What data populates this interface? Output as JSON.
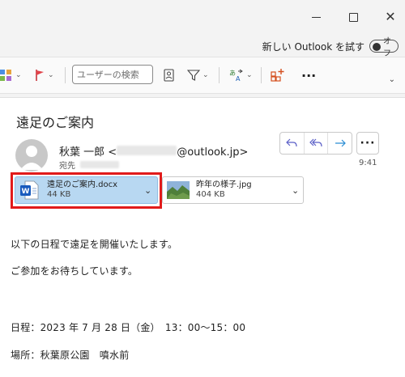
{
  "window": {
    "minimize_glyph": "—",
    "maximize_glyph": "□",
    "close_glyph": "✕"
  },
  "new_outlook": {
    "label": "新しい Outlook を試す",
    "toggle_label": "オフ"
  },
  "ribbon": {
    "search_placeholder": "ユーザーの検索",
    "more_glyph": "···"
  },
  "message": {
    "subject": "遠足のご案内",
    "sender_name": "秋葉 一郎",
    "sender_email_prefix": "<",
    "sender_email_domain": "@outlook.jp>",
    "to_label": "宛先",
    "time": "9:41"
  },
  "attachments": [
    {
      "name": "遠足のご案内.docx",
      "size": "44 KB",
      "type": "word"
    },
    {
      "name": "昨年の様子.jpg",
      "size": "404 KB",
      "type": "image"
    }
  ],
  "body_lines": [
    "以下の日程で遠足を開催いたします。",
    "ご参加をお待ちしています。",
    "日程：2023 年 7 月 28 日（金）　13：00～15：00",
    "場所：秋葉原公園　噴水前"
  ],
  "colors": {
    "accent": "#5b5fc7",
    "selected_attachment": "#b8d8f2",
    "highlight_border": "#e11b1b",
    "word_blue": "#185abd"
  }
}
